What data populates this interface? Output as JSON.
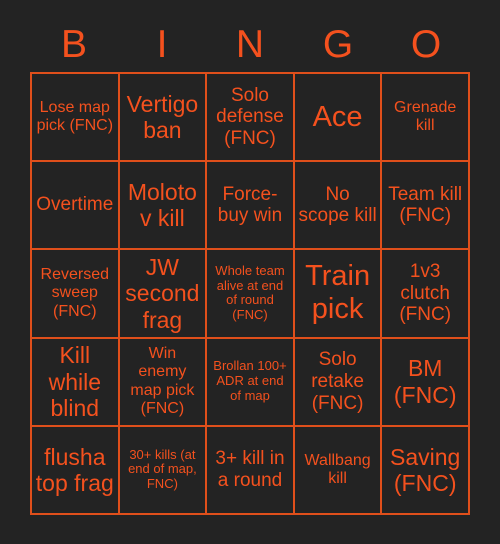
{
  "card": {
    "header_letters": [
      "B",
      "I",
      "N",
      "G",
      "O"
    ],
    "colors": {
      "background": "#232323",
      "border": "#E04F1B",
      "text": "#F4511E"
    },
    "cells": [
      {
        "text": "Lose map pick (FNC)",
        "size": "sm"
      },
      {
        "text": "Vertigo ban",
        "size": "lg"
      },
      {
        "text": "Solo defense (FNC)",
        "size": "md"
      },
      {
        "text": "Ace",
        "size": "xl"
      },
      {
        "text": "Grenade kill",
        "size": "sm"
      },
      {
        "text": "Overtime",
        "size": "md"
      },
      {
        "text": "Molotov kill",
        "size": "lg"
      },
      {
        "text": "Force-buy win",
        "size": "md"
      },
      {
        "text": "No scope kill",
        "size": "md"
      },
      {
        "text": "Team kill (FNC)",
        "size": "md"
      },
      {
        "text": "Reversed sweep (FNC)",
        "size": "sm"
      },
      {
        "text": "JW second frag",
        "size": "lg"
      },
      {
        "text": "Whole team alive at end of round (FNC)",
        "size": "xs"
      },
      {
        "text": "Train pick",
        "size": "xl"
      },
      {
        "text": "1v3 clutch (FNC)",
        "size": "md"
      },
      {
        "text": "Kill while blind",
        "size": "lg"
      },
      {
        "text": "Win enemy map pick (FNC)",
        "size": "sm"
      },
      {
        "text": "Brollan 100+ ADR at end of map",
        "size": "xs"
      },
      {
        "text": "Solo retake (FNC)",
        "size": "md"
      },
      {
        "text": "BM (FNC)",
        "size": "lg"
      },
      {
        "text": "flusha top frag",
        "size": "lg"
      },
      {
        "text": "30+ kills (at end of map, FNC)",
        "size": "xs"
      },
      {
        "text": "3+ kill in a round",
        "size": "md"
      },
      {
        "text": "Wallbang kill",
        "size": "sm"
      },
      {
        "text": "Saving (FNC)",
        "size": "lg"
      }
    ]
  }
}
